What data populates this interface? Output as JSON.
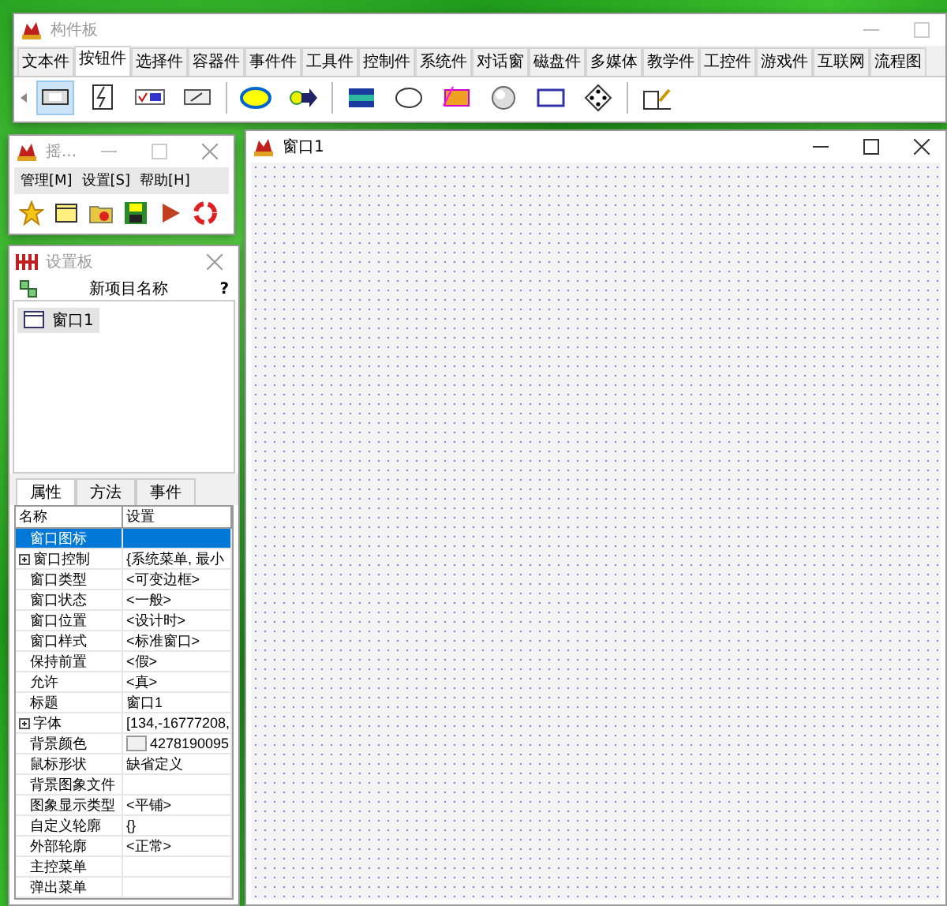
{
  "palette_window": {
    "title": "构件板",
    "tabs": [
      {
        "label": "文本件",
        "selected": false
      },
      {
        "label": "按钮件",
        "selected": true
      },
      {
        "label": "选择件",
        "selected": false
      },
      {
        "label": "容器件",
        "selected": false
      },
      {
        "label": "事件件",
        "selected": false
      },
      {
        "label": "工具件",
        "selected": false
      },
      {
        "label": "控制件",
        "selected": false
      },
      {
        "label": "系统件",
        "selected": false
      },
      {
        "label": "对话窗",
        "selected": false
      },
      {
        "label": "磁盘件",
        "selected": false
      },
      {
        "label": "多媒体",
        "selected": false
      },
      {
        "label": "教学件",
        "selected": false
      },
      {
        "label": "工控件",
        "selected": false
      },
      {
        "label": "游戏件",
        "selected": false
      },
      {
        "label": "互联网",
        "selected": false
      },
      {
        "label": "流程图",
        "selected": false
      }
    ]
  },
  "manager_window": {
    "title": "摇...",
    "menu": [
      "管理[M]",
      "设置[S]",
      "帮助[H]"
    ]
  },
  "settings_panel": {
    "title": "设置板",
    "header": "新项目名称",
    "help": "?",
    "items": [
      {
        "label": "窗口1",
        "selected": false
      }
    ],
    "tabs": [
      {
        "label": "属性",
        "selected": true
      },
      {
        "label": "方法",
        "selected": false
      },
      {
        "label": "事件",
        "selected": false
      }
    ],
    "columns": [
      "名称",
      "设置"
    ],
    "rows": [
      {
        "kind": "item",
        "name": "窗口图标",
        "selected": true
      },
      {
        "kind": "group",
        "name": "窗口控制",
        "value": "{系统菜单, 最小",
        "selected": false
      },
      {
        "kind": "item",
        "name": "窗口类型",
        "value": "<可变边框>",
        "selected": false
      },
      {
        "kind": "item",
        "name": "窗口状态",
        "value": "<一般>",
        "selected": false
      },
      {
        "kind": "item",
        "name": "窗口位置",
        "value": "<设计时>",
        "selected": false
      },
      {
        "kind": "item",
        "name": "窗口样式",
        "value": "<标准窗口>",
        "selected": false
      },
      {
        "kind": "item",
        "name": "保持前置",
        "value": "<假>",
        "selected": false
      },
      {
        "kind": "item",
        "name": "允许",
        "value": "<真>",
        "selected": false
      },
      {
        "kind": "item",
        "name": "标题",
        "value": "窗口1",
        "selected": false
      },
      {
        "kind": "group",
        "name": "字体",
        "value": "[134,-16777208,",
        "selected": false
      },
      {
        "kind": "color",
        "name": "背景颜色",
        "value": "4278190095",
        "selected": false
      },
      {
        "kind": "item",
        "name": "鼠标形状",
        "value": "缺省定义",
        "selected": false
      },
      {
        "kind": "item",
        "name": "背景图象文件",
        "selected": false
      },
      {
        "kind": "item",
        "name": "图象显示类型",
        "value": "<平铺>",
        "selected": false
      },
      {
        "kind": "item",
        "name": "自定义轮廓",
        "value": "{}",
        "selected": false
      },
      {
        "kind": "item",
        "name": "外部轮廓",
        "value": "<正常>",
        "selected": false
      },
      {
        "kind": "item",
        "name": "主控菜单",
        "selected": false
      },
      {
        "kind": "item",
        "name": "弹出菜单",
        "selected": false
      }
    ]
  },
  "design_window": {
    "title": "窗口1"
  }
}
